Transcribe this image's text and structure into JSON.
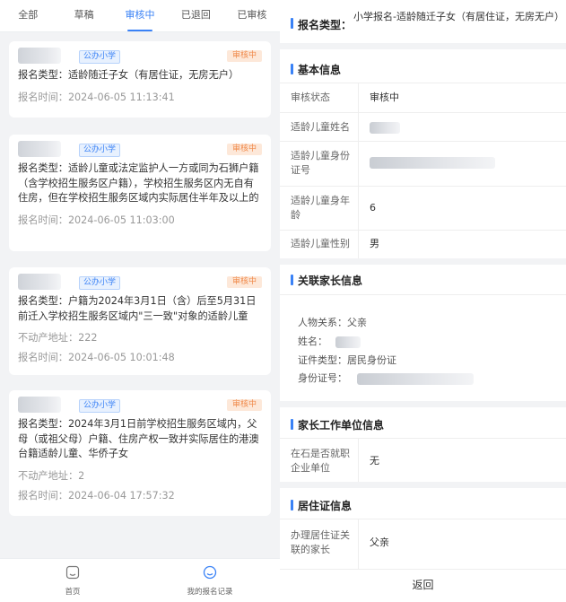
{
  "tabs": [
    "全部",
    "草稿",
    "审核中",
    "已退回",
    "已审核"
  ],
  "active_tab": 2,
  "cards": [
    {
      "school_tag": "公办小学",
      "status": "审核中",
      "type_text": "报名类型：适龄随迁子女（有居住证，无房无户）",
      "extra": [],
      "time_text": "报名时间：2024-06-05 11:13:41"
    },
    {
      "school_tag": "公办小学",
      "status": "审核中",
      "type_text": "报名类型：适龄儿童或法定监护人一方或同为石狮户籍（含学校招生服务区户籍），学校招生服务区内无自有住房，但在学校招生服务区域内实际居住半年及以上的",
      "extra": [],
      "time_text": "报名时间：2024-06-05 11:03:00"
    },
    {
      "school_tag": "公办小学",
      "status": "审核中",
      "type_text": "报名类型：户籍为2024年3月1日（含）后至5月31日前迁入学校招生服务区域内\"三一致\"对象的适龄儿童",
      "extra": [
        "不动产地址：222"
      ],
      "time_text": "报名时间：2024-06-05 10:01:48"
    },
    {
      "school_tag": "公办小学",
      "status": "审核中",
      "type_text": "报名类型：2024年3月1日前学校招生服务区域内，父母（或祖父母）户籍、住房产权一致并实际居住的港澳台籍适龄儿童、华侨子女",
      "extra": [
        "不动产地址：2"
      ],
      "time_text": "报名时间：2024-06-04 17:57:32"
    }
  ],
  "bottom_nav": [
    {
      "label": "首页",
      "icon": "home-icon"
    },
    {
      "label": "我的报名记录",
      "icon": "records-icon"
    }
  ],
  "detail": {
    "type_label": "报名类型：",
    "type_value": "小学报名-适龄随迁子女（有居住证，无房无户）",
    "basic": {
      "title": "基本信息",
      "rows": [
        {
          "label": "审核状态",
          "value": "审核中"
        },
        {
          "label": "适龄儿童姓名",
          "value": " "
        },
        {
          "label": "适龄儿童身份证号",
          "value": ""
        },
        {
          "label": "适龄儿童身年龄",
          "value": "6"
        },
        {
          "label": "适龄儿童性别",
          "value": "男"
        }
      ]
    },
    "parent": {
      "title": "关联家长信息",
      "relation": "人物关系：父亲",
      "name": "姓名：",
      "id_type": "证件类型：居民身份证",
      "id_no": "身份证号："
    },
    "work": {
      "title": "家长工作单位信息",
      "label": "在石是否就职企业单位",
      "value": "无"
    },
    "residence": {
      "title": "居住证信息",
      "label": "办理居住证关联的家长",
      "value": "父亲"
    },
    "back_label": "返回"
  },
  "colors": {
    "accent": "#3a82f6",
    "status_orange": "#f08a4b",
    "bg": "#f2f3f5"
  }
}
